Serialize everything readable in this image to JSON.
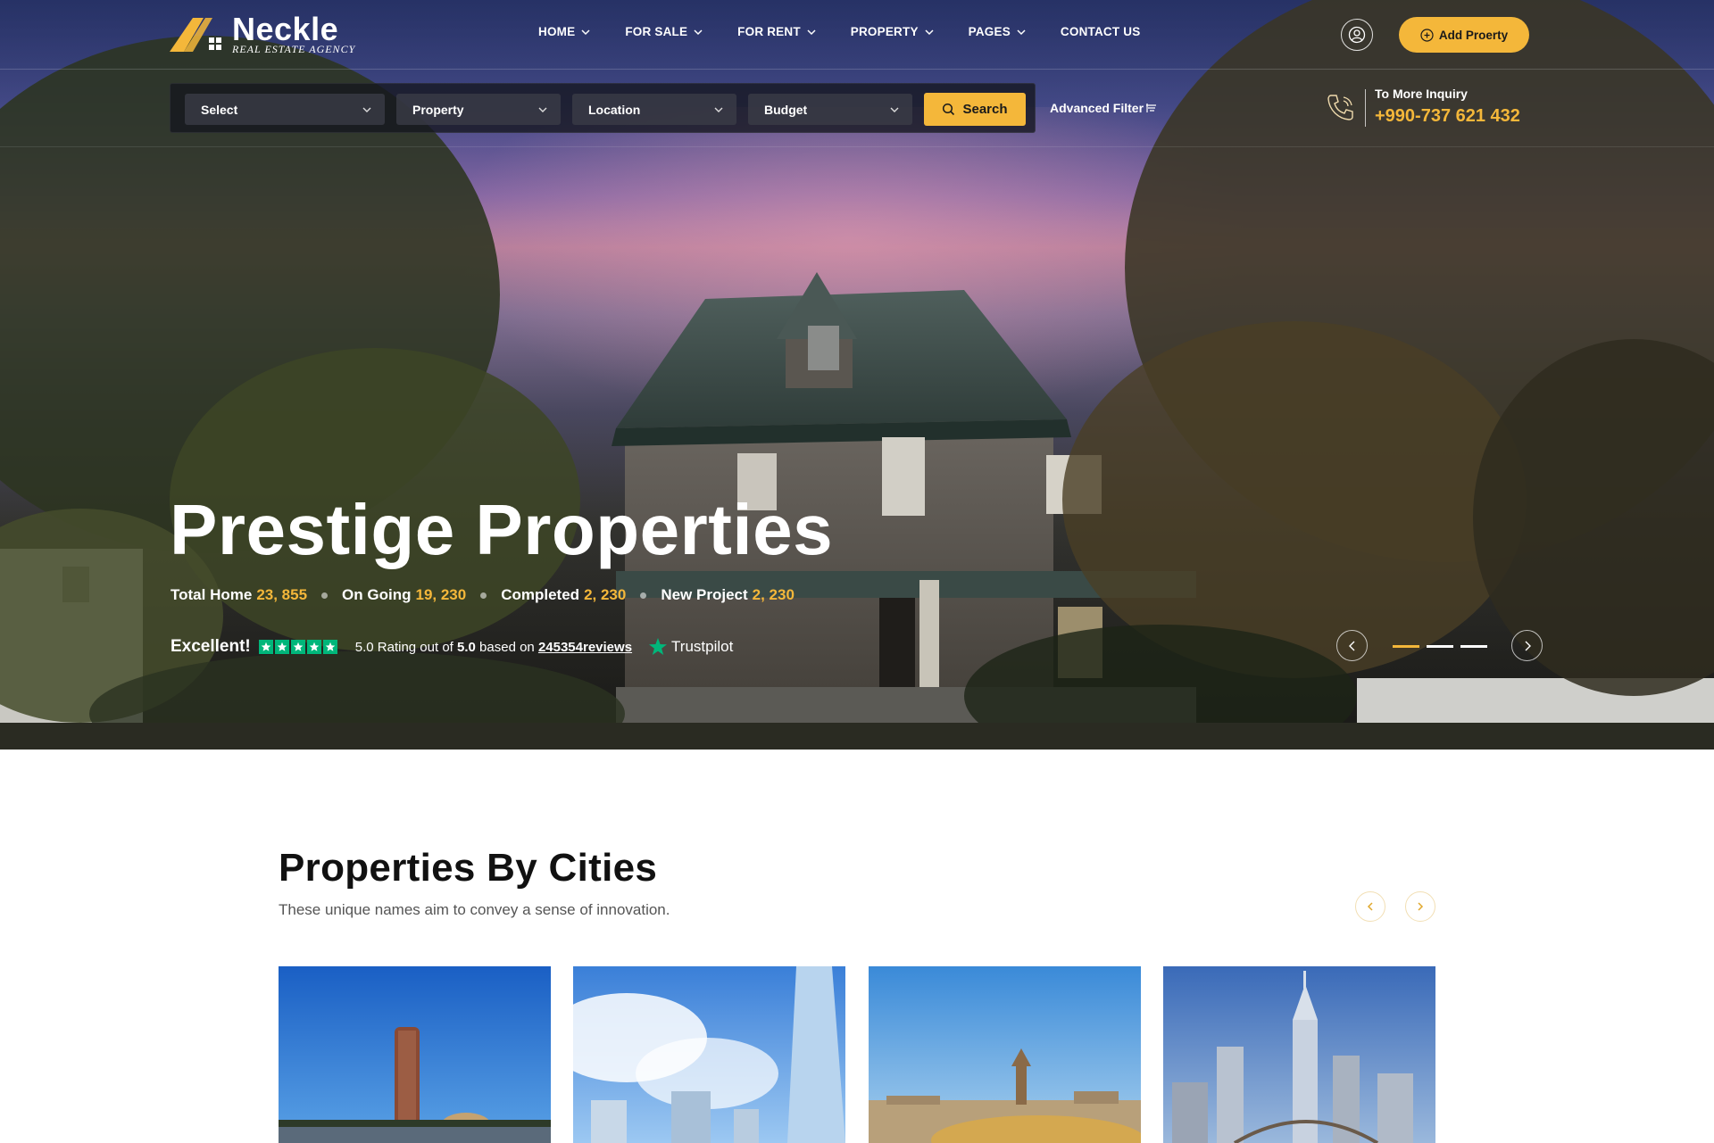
{
  "brand": {
    "name": "Neckle",
    "tagline": "REAL ESTATE AGENCY",
    "accent": "#f4b73a"
  },
  "nav": {
    "items": [
      {
        "label": "HOME",
        "dropdown": true
      },
      {
        "label": "FOR SALE",
        "dropdown": true
      },
      {
        "label": "FOR RENT",
        "dropdown": true
      },
      {
        "label": "PROPERTY",
        "dropdown": true
      },
      {
        "label": "PAGES",
        "dropdown": true
      },
      {
        "label": "CONTACT US",
        "dropdown": false
      }
    ],
    "user_icon": "user-circle-icon",
    "add_property_label": "Add Proerty"
  },
  "search": {
    "selects": [
      {
        "label": "Select"
      },
      {
        "label": "Property"
      },
      {
        "label": "Location"
      },
      {
        "label": "Budget"
      }
    ],
    "button_label": "Search",
    "advanced_filter_label": "Advanced Filter"
  },
  "inquiry": {
    "label": "To More Inquiry",
    "phone": "+990-737 621 432"
  },
  "hero": {
    "title": "Prestige Properties",
    "stats": [
      {
        "label": "Total Home",
        "value": "23, 855"
      },
      {
        "label": "On Going",
        "value": "19, 230"
      },
      {
        "label": "Completed",
        "value": "2, 230"
      },
      {
        "label": "New Project",
        "value": "2, 230"
      }
    ],
    "rating": {
      "excellent_label": "Excellent!",
      "stars": 5,
      "text_prefix": "5.0 Rating out of ",
      "text_max": "5.0",
      "text_mid": " based on ",
      "reviews_link": "245354reviews",
      "provider": "Trustpilot"
    },
    "slider": {
      "slides": 3,
      "active": 1
    }
  },
  "cities": {
    "title": "Properties By Cities",
    "subtitle": "These unique names aim to convey a sense of innovation."
  }
}
